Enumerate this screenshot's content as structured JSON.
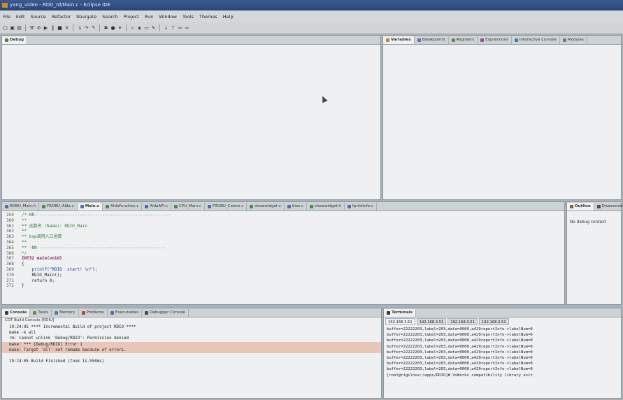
{
  "window": {
    "title": "yang_video - RDD_rd/Main.c - Eclipse IDE"
  },
  "menu": [
    "File",
    "Edit",
    "Source",
    "Refactor",
    "Navigate",
    "Search",
    "Project",
    "Run",
    "Window",
    "Tools",
    "Themes",
    "Help"
  ],
  "debug_view": {
    "tab": "Debug"
  },
  "vars_view": {
    "tabs": [
      "Variables",
      "Breakpoints",
      "Registers",
      "Expressions",
      "Interactive Console",
      "Modules"
    ]
  },
  "editor": {
    "tabs": [
      "RDBU_Main.h",
      "FRDBU_Alda.c",
      "Main.c",
      "AldaFunction.c",
      "AldaAPI.c",
      "CPU_Main.c",
      "FRDBU_Comm.c",
      "showwidget.c",
      "bios.c",
      "showwidget.h",
      "fprintInfo.c"
    ],
    "active_tab": 2,
    "lines": [
      {
        "n": "359",
        "t": "/*-NN------------------------------------------------------",
        "c": "cmt"
      },
      {
        "n": "360",
        "t": "**",
        "c": "cmt"
      },
      {
        "n": "361",
        "t": "** 函数名 (Name): RDIU_Main",
        "c": "cmt"
      },
      {
        "n": "362",
        "t": "**",
        "c": "cmt"
      },
      {
        "n": "363",
        "t": "** bsp调用入口函数",
        "c": "cmt"
      },
      {
        "n": "364",
        "t": "**",
        "c": "cmt"
      },
      {
        "n": "365",
        "t": "** -NN---------------------------------------------------",
        "c": "cmt"
      },
      {
        "n": "366",
        "t": "*/",
        "c": "cmt"
      },
      {
        "n": "367",
        "t": "INT32 main(void)",
        "c": "kw"
      },
      {
        "n": "368",
        "t": "{",
        "c": ""
      },
      {
        "n": "369",
        "t": "    printf(\"RDIO  start! \\n\");",
        "c": "str"
      },
      {
        "n": "370",
        "t": "    RDIO_Main();",
        "c": ""
      },
      {
        "n": "371",
        "t": "    return 0;",
        "c": ""
      },
      {
        "n": "372",
        "t": "}",
        "c": ""
      }
    ]
  },
  "outline": {
    "tabs": [
      "Outline",
      "Disassembly"
    ],
    "message": "No debug context"
  },
  "console": {
    "tabs": [
      "Console",
      "Tasks",
      "Memory",
      "Problems",
      "Executables",
      "Debugger Console"
    ],
    "header": "CDT Build Console [RDIU]",
    "lines": [
      {
        "t": "19:24:05 **** Incremental Build of project RDIO ****",
        "e": false
      },
      {
        "t": "make -k all",
        "e": false
      },
      {
        "t": "rm: cannot unlink 'Debug/RDIO': Permission denied",
        "e": false
      },
      {
        "t": "make: *** [Debug/RDIO] Error 1",
        "e": true
      },
      {
        "t": "make: Target 'all' not remade because of errors.",
        "e": true
      },
      {
        "t": "",
        "e": false
      },
      {
        "t": "19:24:05 Build Finished (took 1s.550ms)",
        "e": false
      }
    ]
  },
  "terminals": {
    "tab": "Terminals",
    "hosts": [
      "192.168.3.51",
      "192.168.3.51",
      "192.168.3.51",
      "192.168.3.51"
    ],
    "lines": [
      "buffer=22222203,label=203,data=0000,a429reportInfo->labelNum=0",
      "buffer=22222203,label=203,data=0000,a429reportInfo->labelNum=0",
      "buffer=22222203,label=203,data=0000,a429reportInfo->labelNum=0",
      "buffer=22222203,label=203,data=0000,a429reportInfo->labelNum=0",
      "buffer=22222203,label=203,data=0000,a429reportInfo->labelNum=0",
      "buffer=22222203,label=203,data=0000,a429reportInfo->labelNum=0",
      "buffer=22222203,label=203,data=0000,a429reportInfo->labelNum=0",
      "buffer=22222203,label=203,data=0000,a429reportInfo->labelNum=0",
      "[root@rigilnux:/apps/RDIO]# VxWorks compatibility library exit."
    ]
  }
}
